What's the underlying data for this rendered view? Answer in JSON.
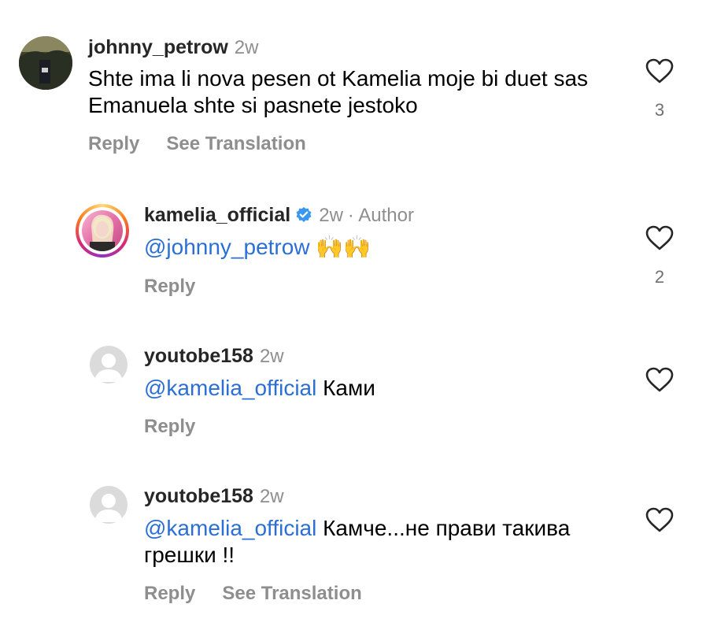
{
  "comments": [
    {
      "username": "johnny_petrow",
      "time": "2w",
      "text": "Shte ima li nova pesen ot Kamelia moje bi duet sas Emanuela shte si pasnete jestoko",
      "like_count": "3",
      "actions": {
        "reply": "Reply",
        "translate": "See Translation"
      }
    },
    {
      "username": "kamelia_official",
      "time": "2w",
      "author_label": "· Author",
      "mention": "@johnny_petrow",
      "text": "🙌🙌",
      "like_count": "2",
      "actions": {
        "reply": "Reply"
      }
    },
    {
      "username": "youtobe158",
      "time": "2w",
      "mention": "@kamelia_official",
      "text": "Ками",
      "actions": {
        "reply": "Reply"
      }
    },
    {
      "username": "youtobe158",
      "time": "2w",
      "mention": "@kamelia_official",
      "text": "Камче...не прави такива грешки !!",
      "actions": {
        "reply": "Reply",
        "translate": "See Translation"
      }
    }
  ],
  "colors": {
    "mention": "#2b6fd4",
    "verified": "#3897f0",
    "muted": "#8e8e8e"
  },
  "icons": [
    "heart-outline-icon",
    "verified-badge-icon",
    "default-avatar-icon"
  ]
}
